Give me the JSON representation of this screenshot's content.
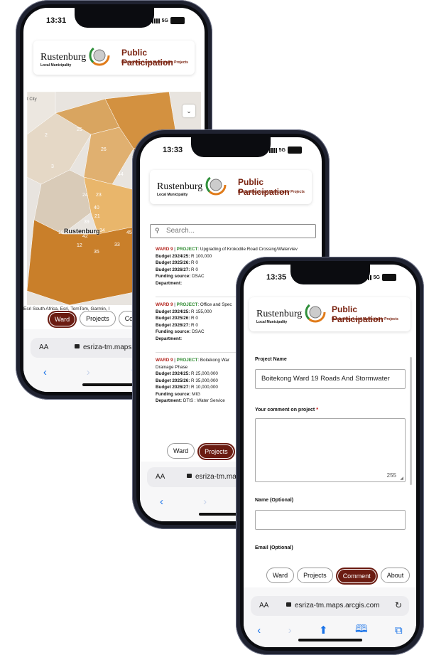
{
  "app": {
    "logo_text": "Rustenburg",
    "logo_sub": "Local Municipality",
    "title": "Public Participation",
    "subtitle": "Rustenburg Local Municipality Projects",
    "url": "esriza-tm.maps.arcgis.com",
    "url_truncated_1": "esriza-tm.maps.ar",
    "url_truncated_2": "esriza-tm.ma",
    "aa": "AA"
  },
  "colors": {
    "brand": "#6b1c12",
    "title": "#7a2310",
    "map_dark": "#c97f2a",
    "map_light": "#e9b66b",
    "link": "#1a73e8"
  },
  "phone1": {
    "time": "13:31",
    "signal": "5G",
    "map_city": "Rustenburg",
    "map_top_label": "t City",
    "map_numbers": [
      "2",
      "25",
      "26",
      "3",
      "44",
      "24",
      "23",
      "40",
      "39",
      "21",
      "18",
      "42",
      "34",
      "33",
      "12",
      "35",
      "45"
    ],
    "attribution": "Esri South Africa, Esri, TomTom, Garmin, I",
    "tabs": [
      "Ward",
      "Projects",
      "Comm"
    ],
    "active_tab": 0
  },
  "phone2": {
    "time": "13:33",
    "signal": "5G",
    "search_placeholder": "Search...",
    "projects": [
      {
        "ward": "WARD 9",
        "label": "PROJECT",
        "name": "Upgrading of Krokodile Road Crossing/Waterviev",
        "b2425": "R 100,000",
        "b2526": "R 0",
        "b2627": "R 0",
        "funding": "DSAC",
        "department": ""
      },
      {
        "ward": "WARD 9",
        "label": "PROJECT",
        "name": "Office and Spec",
        "b2425": "R 155,000",
        "b2526": "R 0",
        "b2627": "R 0",
        "funding": "DSAC",
        "department": ""
      },
      {
        "ward": "WARD 9",
        "label": "PROJECT",
        "name": "Boitekong War",
        "name2": "Drainage Phase",
        "b2425": "R 25,000,000",
        "b2526": "R 35,000,000",
        "b2627": "R 10,000,000",
        "funding": "MIG",
        "department": "DTIS : Water Service"
      }
    ],
    "labels": {
      "b2425": "Budget 2024/25:",
      "b2526": "Budget 2025/26:",
      "b2627": "Budget 2026/27:",
      "funding": "Funding source:",
      "department": "Department:"
    },
    "tabs": [
      "Ward",
      "Projects",
      "C"
    ],
    "active_tab": 1
  },
  "phone3": {
    "time": "13:35",
    "signal": "5G",
    "project_name_label": "Project Name",
    "project_name_value": "Boitekong Ward 19 Roads And Stormwater",
    "comment_label": "Your comment on project",
    "required_mark": "*",
    "char_count": "255",
    "name_label": "Name (Optional)",
    "email_label": "Email (Optional)",
    "tabs": [
      "Ward",
      "Projects",
      "Comment",
      "About"
    ],
    "active_tab": 2
  }
}
